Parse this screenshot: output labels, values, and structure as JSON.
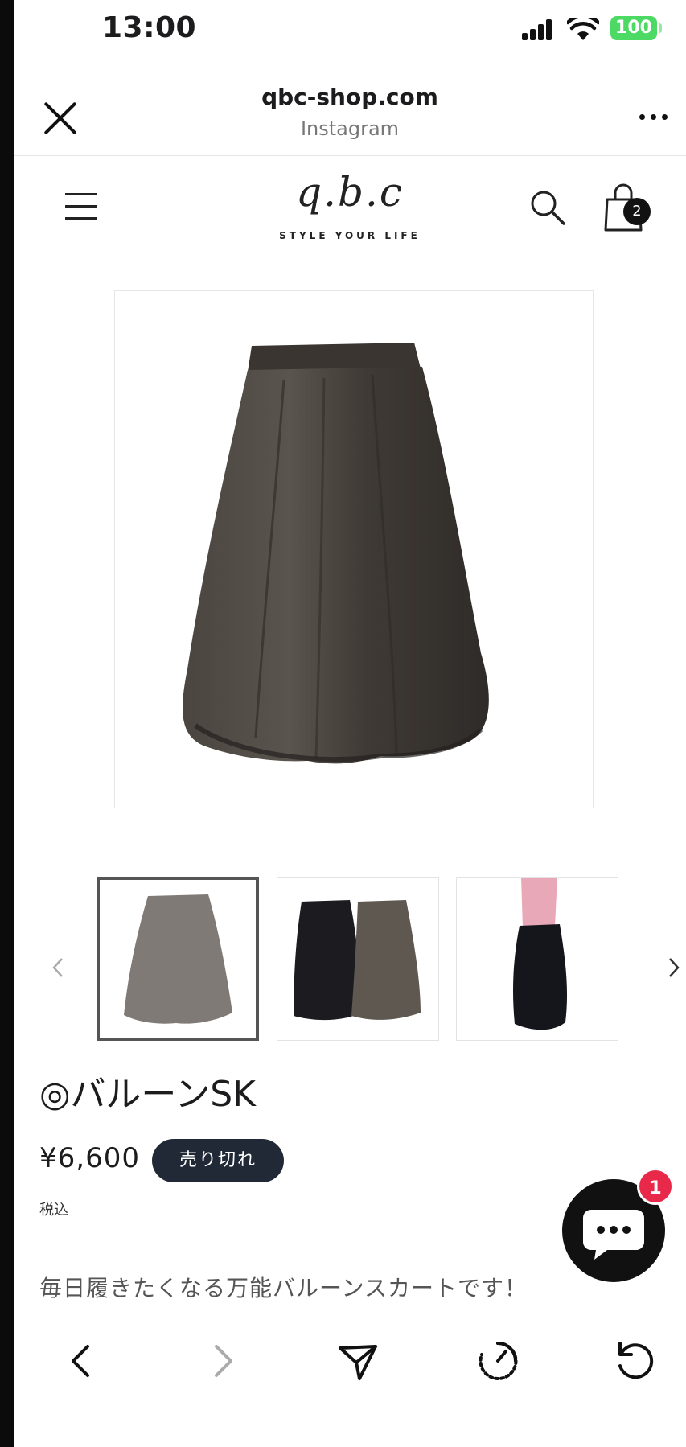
{
  "status_bar": {
    "time": "13:00",
    "battery": "100"
  },
  "browser": {
    "domain": "qbc-shop.com",
    "source": "Instagram"
  },
  "shop_header": {
    "logo_text": "q.b.c",
    "tagline": "STYLE YOUR LIFE",
    "cart_count": "2"
  },
  "product": {
    "title": "◎バルーンSK",
    "price": "¥6,600",
    "sold_out_label": "売り切れ",
    "tax_note": "税込",
    "description": "毎日履きたくなる万能バルーンスカートです！"
  },
  "chat": {
    "badge_count": "1"
  },
  "colors": {
    "sold_out_bg": "#212937",
    "chat_badge": "#e8294a",
    "battery": "#4cd964"
  },
  "icons": [
    "close-icon",
    "more-icon",
    "menu-icon",
    "search-icon",
    "cart-icon",
    "chevron-left-icon",
    "chevron-right-icon",
    "chat-icon",
    "back-icon",
    "forward-icon",
    "share-icon",
    "speed-icon",
    "refresh-icon"
  ]
}
